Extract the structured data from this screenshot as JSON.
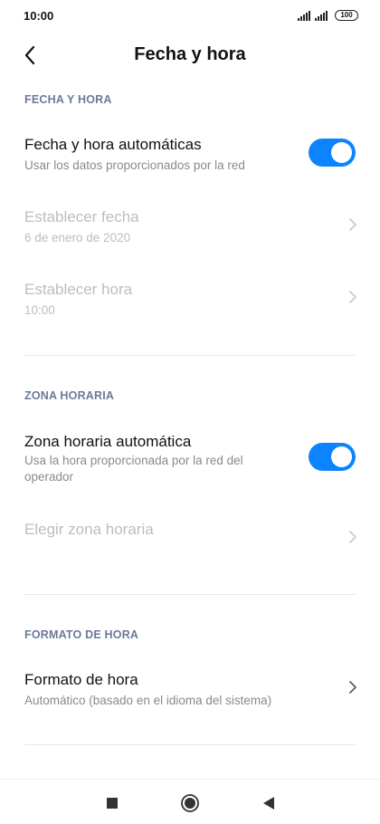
{
  "status_bar": {
    "time": "10:00",
    "battery": "100"
  },
  "header": {
    "title": "Fecha y hora"
  },
  "sections": {
    "fecha_hora": {
      "heading": "FECHA Y HORA",
      "auto": {
        "title": "Fecha y hora automáticas",
        "subtitle": "Usar los datos proporcionados por la red",
        "enabled": true
      },
      "set_date": {
        "title": "Establecer fecha",
        "value": "6 de enero de 2020"
      },
      "set_time": {
        "title": "Establecer hora",
        "value": "10:00"
      }
    },
    "zona": {
      "heading": "ZONA HORARIA",
      "auto": {
        "title": "Zona horaria automática",
        "subtitle_line1": "Usa la hora proporcionada por la red del",
        "subtitle_line2": "operador",
        "enabled": true
      },
      "choose": {
        "title": "Elegir zona horaria"
      }
    },
    "formato": {
      "heading": "FORMATO DE HORA",
      "format": {
        "title": "Formato de hora",
        "value": "Automático (basado en el idioma del sistema)"
      }
    }
  },
  "colors": {
    "accent": "#0d84ff",
    "section_heading": "#6b7a99",
    "disabled_text": "#bdbdbd"
  },
  "icons": {
    "back": "chevron-left-icon",
    "row_arrow": "chevron-right-icon",
    "nav_recents": "square-icon",
    "nav_home": "circle-icon",
    "nav_back": "triangle-left-icon"
  }
}
